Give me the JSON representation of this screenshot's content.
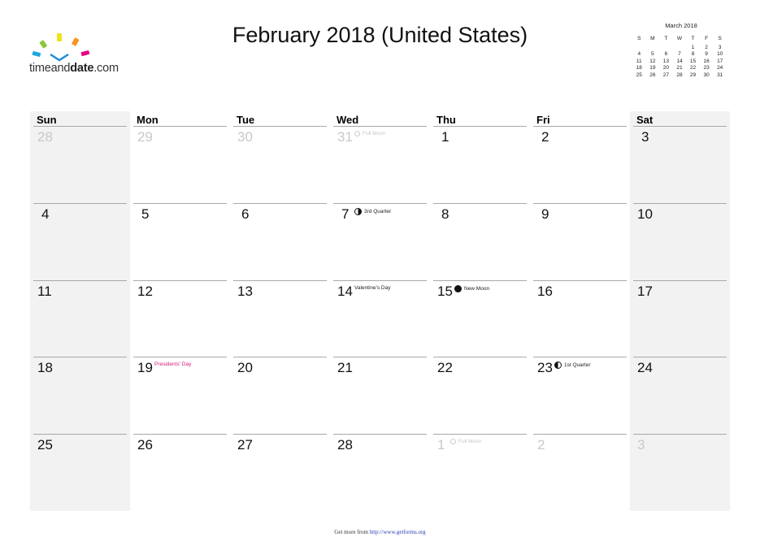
{
  "logo": {
    "text_part1": "timeand",
    "text_part2": "date",
    "text_part3": ".com",
    "colors": [
      "#1fa7e0",
      "#8cc63f",
      "#f0e31c",
      "#f7931e",
      "#e6007e",
      "#1d8cd8"
    ]
  },
  "title": "February 2018 (United States)",
  "mini_calendar": {
    "title": "March 2018",
    "weekdays": [
      "S",
      "M",
      "T",
      "W",
      "T",
      "F",
      "S"
    ],
    "weeks": [
      [
        "",
        "",
        "",
        "",
        "1",
        "2",
        "3"
      ],
      [
        "4",
        "5",
        "6",
        "7",
        "8",
        "9",
        "10"
      ],
      [
        "11",
        "12",
        "13",
        "14",
        "15",
        "16",
        "17"
      ],
      [
        "18",
        "19",
        "20",
        "21",
        "22",
        "23",
        "24"
      ],
      [
        "25",
        "26",
        "27",
        "28",
        "29",
        "30",
        "31"
      ]
    ]
  },
  "weekdays": [
    "Sun",
    "Mon",
    "Tue",
    "Wed",
    "Thu",
    "Fri",
    "Sat"
  ],
  "weeks": [
    [
      {
        "day": "28",
        "other": true
      },
      {
        "day": "29",
        "other": true
      },
      {
        "day": "30",
        "other": true
      },
      {
        "day": "31",
        "other": true,
        "event": "Full Moon",
        "moon": "full"
      },
      {
        "day": "1"
      },
      {
        "day": "2"
      },
      {
        "day": "3"
      }
    ],
    [
      {
        "day": "4"
      },
      {
        "day": "5"
      },
      {
        "day": "6"
      },
      {
        "day": "7",
        "event": "3rd Quarter",
        "moon": "third"
      },
      {
        "day": "8"
      },
      {
        "day": "9"
      },
      {
        "day": "10"
      }
    ],
    [
      {
        "day": "11"
      },
      {
        "day": "12"
      },
      {
        "day": "13"
      },
      {
        "day": "14",
        "event": "Valentine's Day"
      },
      {
        "day": "15",
        "event": "New Moon",
        "moon": "new"
      },
      {
        "day": "16"
      },
      {
        "day": "17"
      }
    ],
    [
      {
        "day": "18"
      },
      {
        "day": "19",
        "event": "Presidents' Day",
        "holiday": true
      },
      {
        "day": "20"
      },
      {
        "day": "21"
      },
      {
        "day": "22"
      },
      {
        "day": "23",
        "event": "1st Quarter",
        "moon": "first"
      },
      {
        "day": "24"
      }
    ],
    [
      {
        "day": "25"
      },
      {
        "day": "26"
      },
      {
        "day": "27"
      },
      {
        "day": "28"
      },
      {
        "day": "1",
        "other": true,
        "event": "Full Moon",
        "moon": "full"
      },
      {
        "day": "2",
        "other": true
      },
      {
        "day": "3",
        "other": true
      }
    ]
  ],
  "footer": {
    "text": "Get more from ",
    "link": "http://www.getforms.org"
  }
}
